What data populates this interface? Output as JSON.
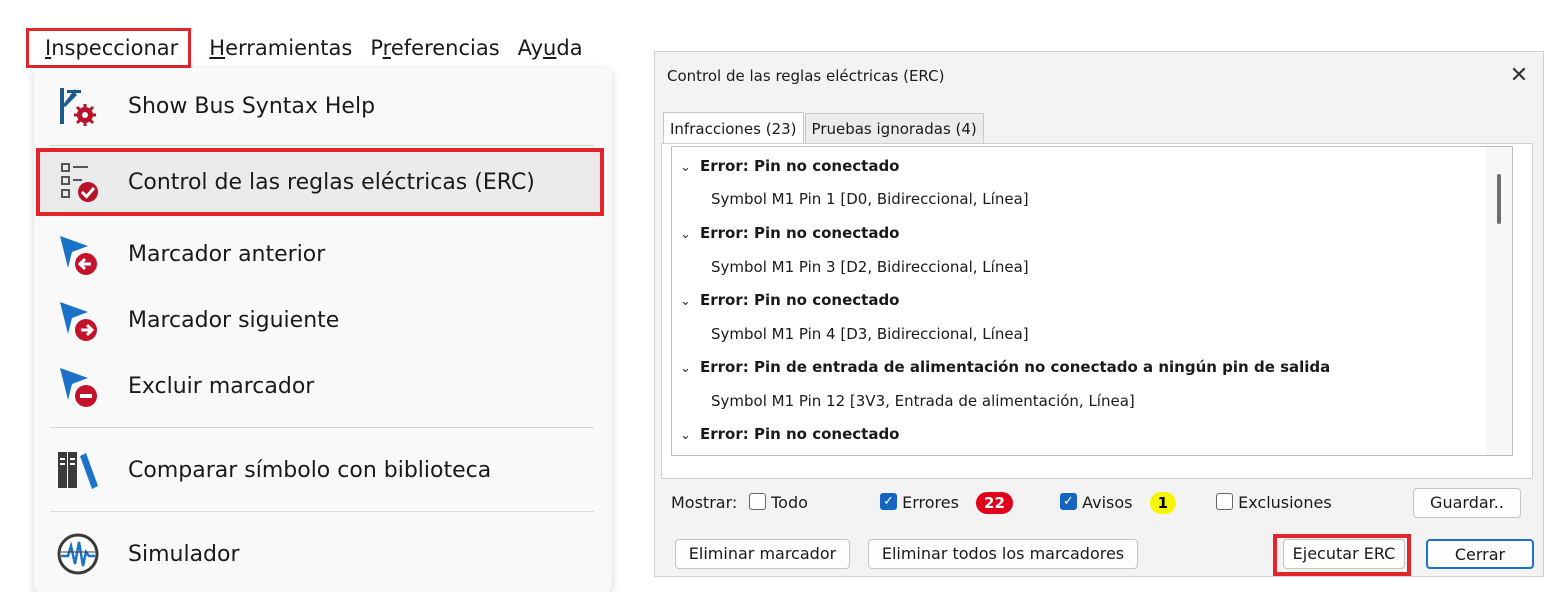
{
  "menubar": {
    "items": [
      {
        "first": "I",
        "rest": "nspeccionar"
      },
      {
        "first": "H",
        "rest": "erramientas"
      },
      {
        "first": "P",
        "rest": "r",
        "pre": "P",
        "text": "Preferencias"
      },
      {
        "text": "Ayuda"
      }
    ],
    "inspect_first": "I",
    "inspect_rest": "nspeccionar",
    "tools_first": "H",
    "tools_rest": "erramientas",
    "prefs_pre": "P",
    "prefs_ul": "r",
    "prefs_rest": "eferencias",
    "help_pre": "Ay",
    "help_ul": "u",
    "help_rest": "da"
  },
  "menu": {
    "items": [
      {
        "label": "Show Bus Syntax Help",
        "icon": "bus-syntax-help-icon"
      },
      {
        "label": "Control de las reglas eléctricas (ERC)",
        "icon": "erc-checklist-icon"
      },
      {
        "label": "Marcador anterior",
        "icon": "previous-marker-icon"
      },
      {
        "label": "Marcador siguiente",
        "icon": "next-marker-icon"
      },
      {
        "label": "Excluir marcador",
        "icon": "exclude-marker-icon"
      },
      {
        "label": "Comparar símbolo con biblioteca",
        "icon": "library-compare-icon"
      },
      {
        "label": "Simulador",
        "icon": "simulator-icon"
      }
    ]
  },
  "dialog": {
    "title": "Control de las reglas eléctricas (ERC)",
    "tabs": [
      {
        "label": "Infracciones (23)",
        "selected": true
      },
      {
        "label": "Pruebas ignoradas (4)",
        "selected": false
      }
    ],
    "violations": [
      {
        "type": "Error: Pin no conectado",
        "detail": "Symbol M1 Pin 1 [D0, Bidireccional, Línea]"
      },
      {
        "type": "Error: Pin no conectado",
        "detail": "Symbol M1 Pin 3 [D2, Bidireccional, Línea]"
      },
      {
        "type": "Error: Pin no conectado",
        "detail": "Symbol M1 Pin 4 [D3, Bidireccional, Línea]"
      },
      {
        "type": "Error: Pin de entrada de alimentación no conectado a ningún pin de salida",
        "detail": "Symbol M1 Pin 12 [3V3, Entrada de alimentación, Línea]"
      },
      {
        "type": "Error: Pin no conectado",
        "detail": ""
      }
    ],
    "filters": {
      "show_label": "Mostrar:",
      "all_label": "Todo",
      "all_checked": false,
      "errors_label": "Errores",
      "errors_checked": true,
      "errors_count": "22",
      "warnings_label": "Avisos",
      "warnings_checked": true,
      "warnings_count": "1",
      "exclusions_label": "Exclusiones",
      "exclusions_checked": false,
      "save_label": "Guardar.."
    },
    "buttons": {
      "delete_marker": "Eliminar marcador",
      "delete_all_markers": "Eliminar todos los marcadores",
      "run_erc": "Ejecutar ERC",
      "close": "Cerrar"
    },
    "close_glyph": "✕",
    "chevron_glyph": "⌄",
    "check_glyph": "✓"
  },
  "colors": {
    "highlight_red": "#e0262b",
    "accent_blue": "#1565c0",
    "badge_red": "#e0001b",
    "badge_yellow": "#f6f600"
  }
}
